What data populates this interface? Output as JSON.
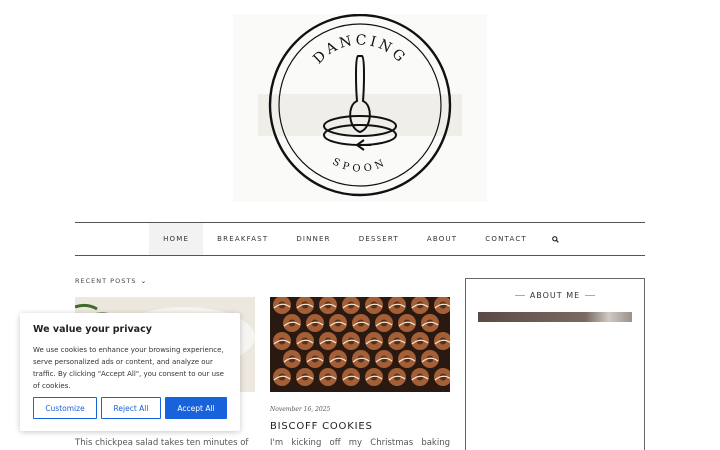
{
  "logo": {
    "top_text": "DANCING",
    "bottom_text": "SPOON"
  },
  "nav": {
    "items": [
      {
        "label": "HOME",
        "active": true
      },
      {
        "label": "BREAKFAST",
        "active": false
      },
      {
        "label": "DINNER",
        "active": false
      },
      {
        "label": "DESSERT",
        "active": false
      },
      {
        "label": "ABOUT",
        "active": false
      },
      {
        "label": "CONTACT",
        "active": false
      }
    ],
    "search_icon": "search-icon"
  },
  "recent_posts": {
    "label": "RECENT POSTS",
    "chevron": "⌄"
  },
  "posts": [
    {
      "excerpt": "This chickpea salad takes ten minutes of"
    },
    {
      "date": "November 16, 2025",
      "title": "BISCOFF COOKIES",
      "excerpt": "I'm kicking off my Christmas baking season"
    }
  ],
  "sidebar": {
    "about_title": "ABOUT ME"
  },
  "cookie_banner": {
    "title": "We value your privacy",
    "body": "We use cookies to enhance your browsing experience, serve personalized ads or content, and analyze our traffic. By clicking \"Accept All\", you consent to our use of cookies.",
    "customize_label": "Customize",
    "reject_label": "Reject All",
    "accept_label": "Accept All"
  },
  "colors": {
    "accent": "#1863dc",
    "rule": "#555555"
  }
}
